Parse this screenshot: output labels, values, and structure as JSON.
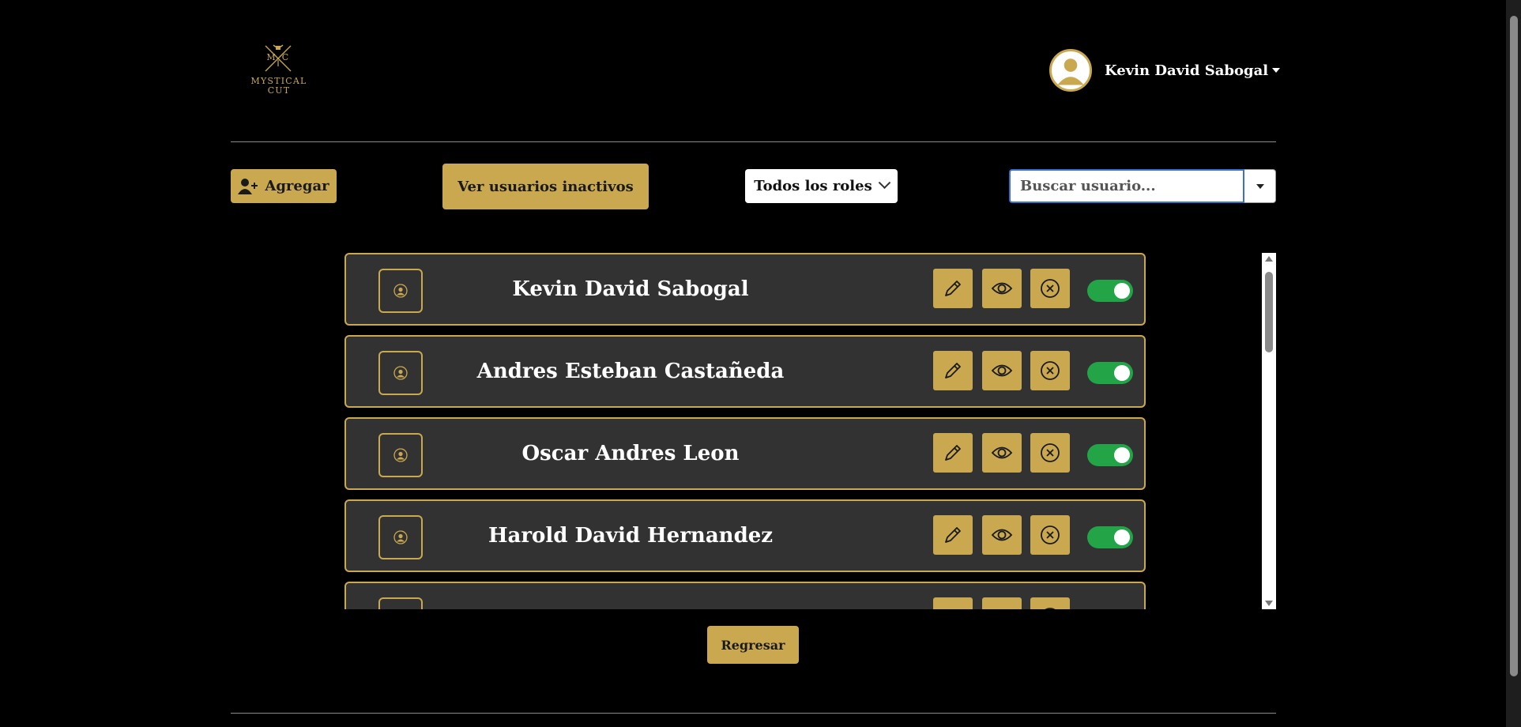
{
  "header": {
    "logo": {
      "icon": "mystical-cut-logo",
      "line1": "MYSTICAL",
      "line2": "CUT",
      "initials": [
        "M",
        "C"
      ],
      "color": "#C9A84F"
    },
    "user": {
      "name": "Kevin David Sabogal",
      "avatar_icon": "user-avatar-icon"
    }
  },
  "toolbar": {
    "add_label": "Agregar",
    "inactive_label": "Ver usuarios inactivos",
    "roles_selected": "Todos los roles",
    "search_placeholder": "Buscar usuario..."
  },
  "users": [
    {
      "name": "Kevin David Sabogal",
      "active": true
    },
    {
      "name": "Andres Esteban Castañeda",
      "active": true
    },
    {
      "name": "Oscar Andres Leon",
      "active": true
    },
    {
      "name": "Harold David Hernandez",
      "active": true
    }
  ],
  "footer": {
    "back_label": "Regresar"
  },
  "colors": {
    "accent": "#C9A84F",
    "row_bg": "#323232",
    "toggle_on": "#22a447",
    "background": "#000000"
  }
}
